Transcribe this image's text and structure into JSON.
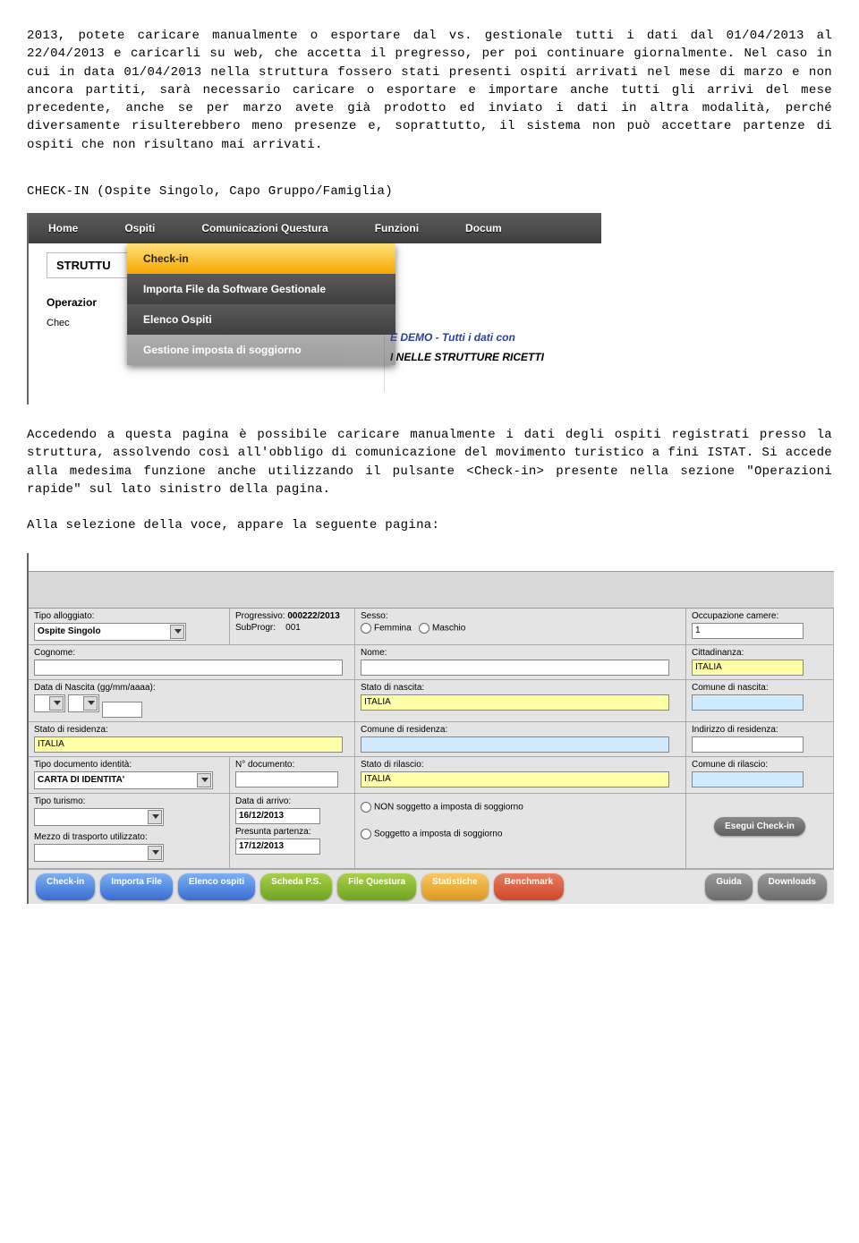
{
  "para1": "2013, potete caricare manualmente o esportare dal vs. gestionale tutti i dati dal 01/04/2013 al 22/04/2013 e caricarli su web, che accetta il pregresso, per poi continuare giornalmente. Nel caso in cui in data 01/04/2013 nella struttura fossero stati presenti ospiti arrivati nel mese di marzo e non ancora partiti, sarà necessario caricare o esportare e importare anche tutti gli arrivi del mese precedente, anche se per marzo avete già prodotto ed inviato i dati in altra modalità, perché diversamente risulterebbero meno presenze e, soprattutto, il sistema non può accettare partenze di ospiti che non risultano mai arrivati.",
  "heading1": "CHECK-IN (Ospite Singolo, Capo Gruppo/Famiglia)",
  "nav": {
    "home": "Home",
    "ospiti": "Ospiti",
    "comunicazioni": "Comunicazioni Questura",
    "funzioni": "Funzioni",
    "docum": "Docum"
  },
  "box1": "STRUTTU",
  "operazior": "Operazior",
  "chec": "Chec",
  "dd": {
    "checkin": "Check-in",
    "importa": "Importa File da Software Gestionale",
    "elenco": "Elenco Ospiti",
    "gestione": "Gestione imposta di soggiorno"
  },
  "rp1": "E DEMO - Tutti i dati con",
  "rp2": "I NELLE STRUTTURE RICETTI",
  "para2": "Accedendo a questa pagina è possibile caricare manualmente i dati degli ospiti registrati presso la struttura, assolvendo così all'obbligo di comunicazione del movimento turistico a fini ISTAT. Si accede alla medesima funzione anche utilizzando il pulsante <Check-in> presente nella sezione \"Operazioni rapide\" sul lato sinistro della pagina.",
  "para3": "Alla selezione della voce, appare la seguente pagina:",
  "form": {
    "tipoAlloggiato": {
      "label": "Tipo alloggiato:",
      "value": "Ospite Singolo"
    },
    "progressivo": {
      "label": "Progressivo:",
      "value": "000222/2013"
    },
    "subprogr": {
      "label": "SubProgr:",
      "value": "001"
    },
    "sesso": {
      "label": "Sesso:",
      "femmina": "Femmina",
      "maschio": "Maschio"
    },
    "occupazione": {
      "label": "Occupazione camere:",
      "value": "1"
    },
    "cognome": "Cognome:",
    "nome": "Nome:",
    "cittadinanza": {
      "label": "Cittadinanza:",
      "value": "ITALIA"
    },
    "dataNascita": "Data di Nascita (gg/mm/aaaa):",
    "statoNascita": {
      "label": "Stato di nascita:",
      "value": "ITALIA"
    },
    "comuneNascita": "Comune di nascita:",
    "statoResidenza": {
      "label": "Stato di residenza:",
      "value": "ITALIA"
    },
    "comuneResidenza": "Comune di residenza:",
    "indirizzoResidenza": "Indirizzo di residenza:",
    "tipoDocumento": {
      "label": "Tipo documento identità:",
      "value": "CARTA DI IDENTITA'"
    },
    "nDocumento": "N° documento:",
    "statoRilascio": {
      "label": "Stato di rilascio:",
      "value": "ITALIA"
    },
    "comuneRilascio": "Comune di rilascio:",
    "tipoTurismo": "Tipo turismo:",
    "mezzoTrasporto": "Mezzo di trasporto utilizzato:",
    "dataArrivo": {
      "label": "Data di arrivo:",
      "value": "16/12/2013"
    },
    "presunta": {
      "label": "Presunta partenza:",
      "value": "17/12/2013"
    },
    "nonSoggetto": "NON soggetto a imposta di soggiorno",
    "soggetto": "Soggetto a imposta di soggiorno",
    "esegui": "Esegui Check-in"
  },
  "buttons": {
    "checkin": "Check-in",
    "importa": "Importa File",
    "elenco": "Elenco ospiti",
    "scheda": "Scheda P.S.",
    "fileq": "File Questura",
    "stat": "Statistiche",
    "bench": "Benchmark",
    "guida": "Guida",
    "down": "Downloads"
  }
}
